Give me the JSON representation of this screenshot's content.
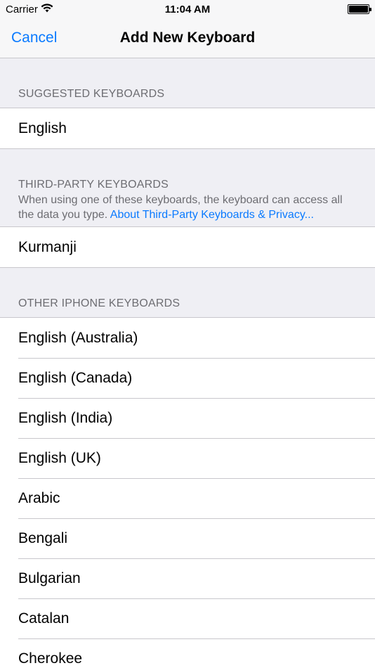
{
  "status": {
    "carrier": "Carrier",
    "time": "11:04 AM",
    "battery_level": 1.0
  },
  "nav": {
    "cancel_label": "Cancel",
    "title": "Add New Keyboard"
  },
  "sections": {
    "suggested": {
      "header": "SUGGESTED KEYBOARDS",
      "items": [
        "English"
      ]
    },
    "third_party": {
      "header": "THIRD-PARTY KEYBOARDS",
      "description": "When using one of these keyboards, the keyboard can access all the data you type. ",
      "link_text": "About Third-Party Keyboards & Privacy...",
      "items": [
        "Kurmanji"
      ]
    },
    "other": {
      "header": "OTHER IPHONE KEYBOARDS",
      "items": [
        "English (Australia)",
        "English (Canada)",
        "English (India)",
        "English (UK)",
        "Arabic",
        "Bengali",
        "Bulgarian",
        "Catalan",
        "Cherokee"
      ]
    }
  },
  "colors": {
    "accent": "#0a7aff",
    "background": "#efeff4",
    "secondary_text": "#6d6d72",
    "separator": "#c8c7cc"
  },
  "icons": {
    "wifi": "wifi-icon",
    "battery": "battery-icon"
  }
}
